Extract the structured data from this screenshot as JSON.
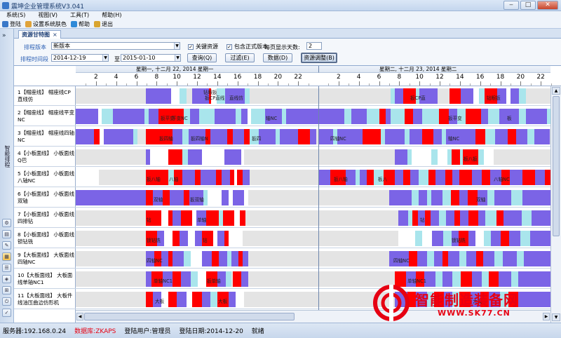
{
  "window": {
    "title": "震坤企业管理系统V3.041"
  },
  "menu": [
    {
      "label": "系统(S)"
    },
    {
      "label": "视图(V)"
    },
    {
      "label": "工具(T)"
    },
    {
      "label": "帮助(H)"
    }
  ],
  "toolbar": [
    {
      "label": "登陆",
      "icon": "login-icon",
      "color": "#3a78c8"
    },
    {
      "label": "设置系统肤色",
      "icon": "palette-icon",
      "color": "#e0a33a"
    },
    {
      "label": "帮助",
      "icon": "help-icon",
      "color": "#2f8ad8"
    },
    {
      "label": "退出",
      "icon": "exit-icon",
      "color": "#d9a530"
    }
  ],
  "sidebar": {
    "collapse": "»",
    "label": "智能排程"
  },
  "tab": {
    "label": "资源甘特图",
    "close": "×"
  },
  "form": {
    "plan_label": "排程版本",
    "plan_value": "新版本",
    "time_label": "排程时间段",
    "date_from": "2014-12-19",
    "to_label": "至",
    "date_to": "2015-01-10",
    "chk_key": "关键资源",
    "chk_formal": "包含正式版本",
    "days_label": "每页显示天数:",
    "days_value": "2",
    "buttons": {
      "query": "查询(Q)",
      "filter": "过滤(E)",
      "data": "数据(D)",
      "adjust": "资源调整(B)"
    }
  },
  "gantt": {
    "days": [
      "星期一, 十二月 22, 2014 星期一",
      "星期二, 十二月 23, 2014 星期二"
    ],
    "ticks": [
      "2",
      "4",
      "6",
      "8",
      "10",
      "12",
      "14",
      "16",
      "18",
      "20",
      "22"
    ],
    "resources": [
      {
        "name": "1【帽座线】 帽座线CP直线仿"
      },
      {
        "name": "2【帽座线】 帽座线平变NC"
      },
      {
        "name": "3【帽座线】 帽座线四轴NC"
      },
      {
        "name": "4【小板面线】 小板面线Q巴"
      },
      {
        "name": "5【小板面线】 小板面线八轴NC"
      },
      {
        "name": "6【小板面线】 小板面线双轴"
      },
      {
        "name": "7【小板面线】 小板面线四排钻"
      },
      {
        "name": "8【小板面线】 小板面线锁钻铣"
      },
      {
        "name": "9【大板面线】 大板面线四轴NC"
      },
      {
        "name": "10【大板面线】 大板面线单轴NC1"
      },
      {
        "name": "11【大板面线】 大板件线油压曲边仿形机"
      }
    ],
    "labels": [
      "钻眼扳",
      "扳CP直线",
      "直线仿",
      "扳CP直",
      "扳平变",
      "扳平",
      "板",
      "平变NC",
      "轴NC",
      "扳四轴",
      "扳四轴N",
      "扳四",
      "四轴NC",
      "八轴NC",
      "扳八轴",
      "八轴",
      "板八",
      "扳",
      "双轴",
      "扳双轴",
      "单轴",
      "钻",
      "锁钻铣",
      "单轴NC1",
      "扳单轴",
      "大板"
    ],
    "legend_colors": {
      "planned": "#7b64e6",
      "urgent": "#ff0000",
      "setup": "#a9e5ec",
      "idle": "#ffffff"
    }
  },
  "status": {
    "server": "服务器:192.168.0.24",
    "database": "数据库:ZKAPS",
    "user": "登陆用户:管理员",
    "date": "登陆日期:2014-12-20",
    "state": "就绪",
    "database_color": "#e60012"
  },
  "watermark": {
    "cn": "智能制造装备网",
    "url": "WWW.SK77.CN"
  }
}
